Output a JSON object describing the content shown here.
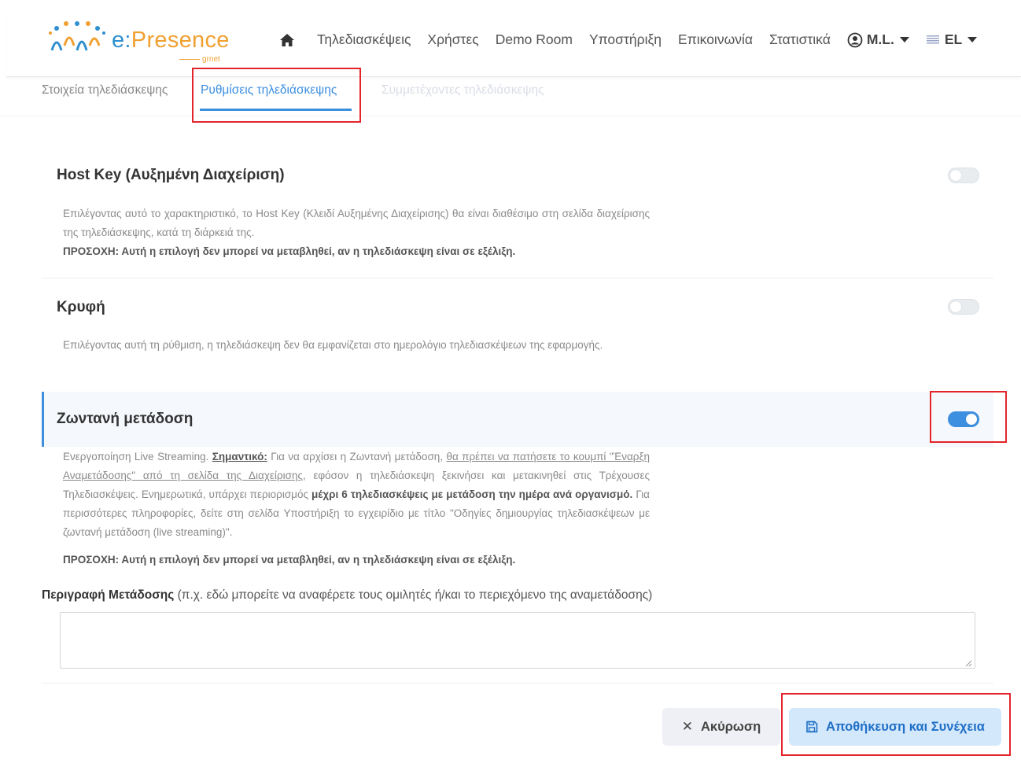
{
  "header": {
    "logo_text_prefix": "e:",
    "logo_text_main": "Presence",
    "logo_sub": "grnet",
    "nav": {
      "home_icon": "home-icon",
      "items": [
        "Τηλεδιασκέψεις",
        "Χρήστες",
        "Demo Room",
        "Υποστήριξη",
        "Επικοινωνία",
        "Στατιστικά"
      ],
      "user_label": "M.L.",
      "lang_label": "EL"
    }
  },
  "tabs": [
    {
      "label": "Στοιχεία τηλεδιάσκεψης",
      "active": false
    },
    {
      "label": "Ρυθμίσεις τηλεδιάσκεψης",
      "active": true
    },
    {
      "label": "Συμμετέχοντες τηλεδιάσκεψης",
      "active": false,
      "disabled": true
    }
  ],
  "settings": {
    "host_key": {
      "title": "Host Key (Αυξημένη Διαχείριση)",
      "desc": "Επιλέγοντας αυτό το χαρακτηριστικό, το Host Key (Κλειδί Αυξημένης Διαχείρισης) θα είναι διαθέσιμο στη σελίδα διαχείρισης της τηλεδιάσκεψης, κατά τη διάρκειά της.",
      "warning": "ΠΡΟΣΟΧΗ: Αυτή η επιλογή δεν μπορεί να μεταβληθεί, αν η τηλεδιάσκεψη είναι σε εξέλιξη.",
      "enabled": false
    },
    "hidden": {
      "title": "Κρυφή",
      "desc": "Επιλέγοντας αυτή τη ρύθμιση, η τηλεδιάσκεψη δεν θα εμφανίζεται στο ημερολόγιο τηλεδιασκέψεων της εφαρμογής.",
      "enabled": false
    },
    "live": {
      "title": "Ζωντανή μετάδοση",
      "enabled": true,
      "desc_1": "Ενεργοποίηση Live Streaming. ",
      "important": "Σημαντικό:",
      "desc_2": " Για να αρχίσει η Ζωντανή μετάδοση, ",
      "link": "θα πρέπει να πατήσετε το κουμπί \"Έναρξη Αναμετάδοσης\" από τη σελίδα της Διαχείρισης",
      "desc_3": ", εφόσον η τηλεδιάσκεψη ξεκινήσει και μετακινηθεί στις Τρέχουσες Τηλεδιασκέψεις. Ενημερωτικά, υπάρχει περιορισμός ",
      "limit": "μέχρι 6 τηλεδιασκέψεις με μετάδοση την ημέρα ανά οργανισμό.",
      "desc_4": " Για περισσότερες πληροφορίες, δείτε στη σελίδα Υποστήριξη το εγχειρίδιο με τίτλο \"Οδηγίες δημιουργίας τηλεδιασκέψεων με ζωντανή μετάδοση (live streaming)\".",
      "warning": "ΠΡΟΣΟΧΗ: Αυτή η επιλογή δεν μπορεί να μεταβληθεί, αν η τηλεδιάσκεψη είναι σε εξέλιξη."
    }
  },
  "description_field": {
    "label_bold": "Περιγραφή Μετάδοσης",
    "label_rest": " (π.χ. εδώ μπορείτε να αναφέρετε τους ομιλητές ή/και το περιεχόμενο της αναμετάδοσης)",
    "value": ""
  },
  "buttons": {
    "cancel": "Ακύρωση",
    "save": "Αποθήκευση και Συνέχεια"
  },
  "colors": {
    "accent": "#3d8fe0",
    "highlight": "#e3252b",
    "logo_orange": "#f0a030"
  }
}
